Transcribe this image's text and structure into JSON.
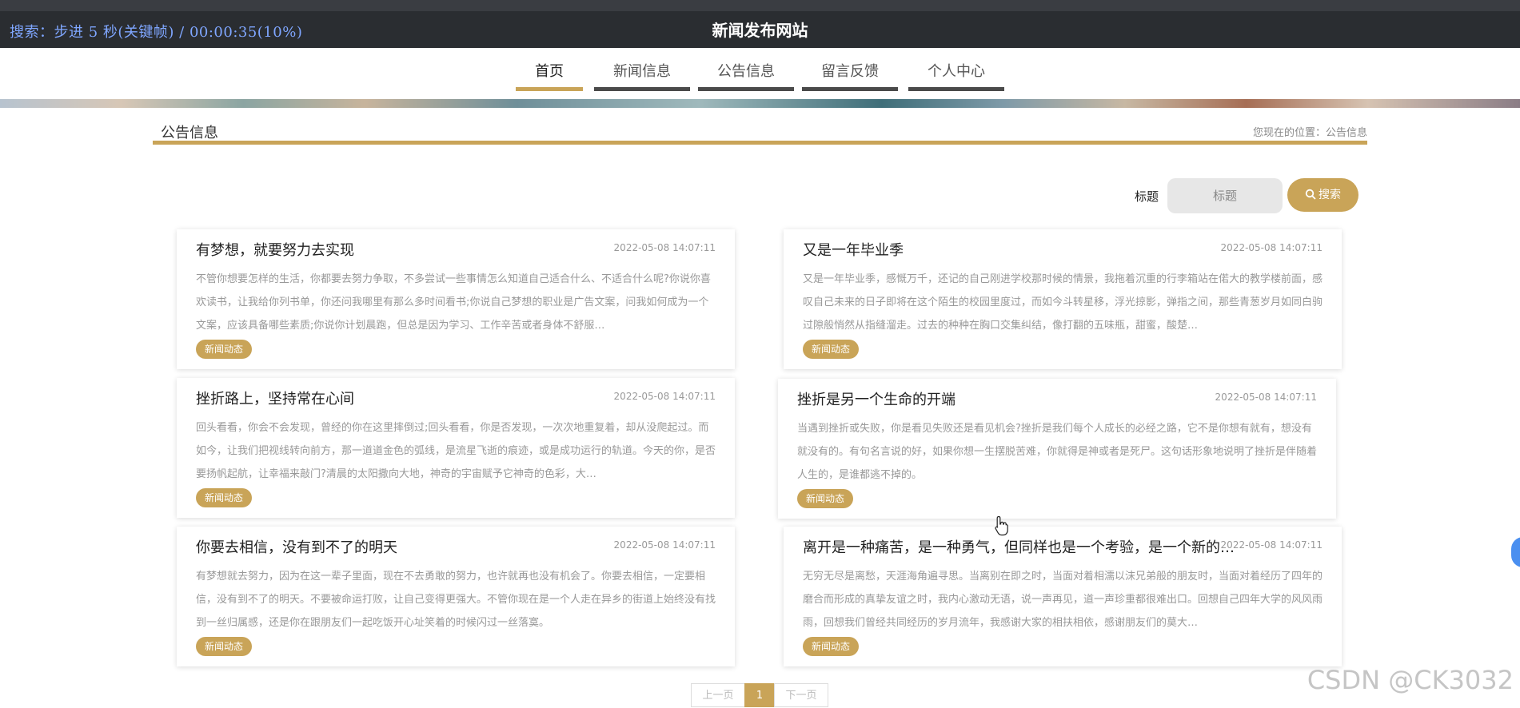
{
  "overlay": {
    "seek_status": "搜索：步进 5 秒(关键帧) / 00:00:35(10%)"
  },
  "site": {
    "title": "新闻发布网站"
  },
  "nav": {
    "items": [
      {
        "label": "首页",
        "active": true
      },
      {
        "label": "新闻信息",
        "active": false
      },
      {
        "label": "公告信息",
        "active": false
      },
      {
        "label": "留言反馈",
        "active": false
      },
      {
        "label": "个人中心",
        "active": false
      }
    ]
  },
  "section": {
    "title": "公告信息",
    "breadcrumb": "您现在的位置：公告信息"
  },
  "search": {
    "label": "标题",
    "placeholder": "标题",
    "button_label": "搜索"
  },
  "cards": [
    {
      "title": "有梦想，就要努力去实现",
      "date": "2022-05-08 14:07:11",
      "body": "不管你想要怎样的生活，你都要去努力争取，不多尝试一些事情怎么知道自己适合什么、不适合什么呢?你说你喜欢读书，让我给你列书单，你还问我哪里有那么多时间看书;你说自己梦想的职业是广告文案，问我如何成为一个文案，应该具备哪些素质;你说你计划晨跑，但总是因为学习、工作辛苦或者身体不舒服…",
      "tag": "新闻动态"
    },
    {
      "title": "又是一年毕业季",
      "date": "2022-05-08 14:07:11",
      "body": "又是一年毕业季，感慨万千，还记的自己刚进学校那时候的情景，我拖着沉重的行李箱站在偌大的教学楼前面，感叹自己未来的日子即将在这个陌生的校园里度过，而如今斗转星移，浮光掠影，弹指之间，那些青葱岁月如同白驹过隙般悄然从指缝溜走。过去的种种在胸口交集纠结，像打翻的五味瓶，甜蜜，酸楚…",
      "tag": "新闻动态"
    },
    {
      "title": "挫折路上，坚持常在心间",
      "date": "2022-05-08 14:07:11",
      "body": "回头看看，你会不会发现，曾经的你在这里摔倒过;回头看看，你是否发现，一次次地重复着，却从没爬起过。而如今，让我们把视线转向前方，那一道道金色的弧线，是流星飞逝的痕迹，或是成功运行的轨道。今天的你，是否要扬帆起航，让幸福来敲门?清晨的太阳撒向大地，神奇的宇宙赋予它神奇的色彩，大…",
      "tag": "新闻动态"
    },
    {
      "title": "挫折是另一个生命的开端",
      "date": "2022-05-08 14:07:11",
      "body": "当遇到挫折或失败，你是看见失败还是看见机会?挫折是我们每个人成长的必经之路，它不是你想有就有，想没有就没有的。有句名言说的好，如果你想一生摆脱苦难，你就得是神或者是死尸。这句话形象地说明了挫折是伴随着人生的，是谁都逃不掉的。",
      "tag": "新闻动态"
    },
    {
      "title": "你要去相信，没有到不了的明天",
      "date": "2022-05-08 14:07:11",
      "body": "有梦想就去努力，因为在这一辈子里面，现在不去勇敢的努力，也许就再也没有机会了。你要去相信，一定要相信，没有到不了的明天。不要被命运打败，让自己变得更强大。不管你现在是一个人走在异乡的街道上始终没有找到一丝归属感，还是你在跟朋友们一起吃饭开心址笑着的时候闪过一丝落寞。",
      "tag": "新闻动态"
    },
    {
      "title": "离开是一种痛苦，是一种勇气，但同样也是一个考验，是一个新的…",
      "date": "2022-05-08 14:07:11",
      "body": "无穷无尽是离愁，天涯海角遍寻思。当离别在即之时，当面对着相濡以沫兄弟般的朋友时，当面对着经历了四年的磨合而形成的真挚友谊之时，我内心激动无语，说一声再见，道一声珍重都很难出口。回想自己四年大学的风风雨雨，回想我们曾经共同经历的岁月流年，我感谢大家的相扶相依，感谢朋友们的莫大…",
      "tag": "新闻动态"
    }
  ],
  "pagination": {
    "prev": "上一页",
    "current": "1",
    "next": "下一页"
  },
  "watermark": "CSDN @CK3032",
  "colors": {
    "accent": "#c9a458",
    "topbar": "#2a2d31",
    "overlay_text": "#7fa6ff"
  }
}
